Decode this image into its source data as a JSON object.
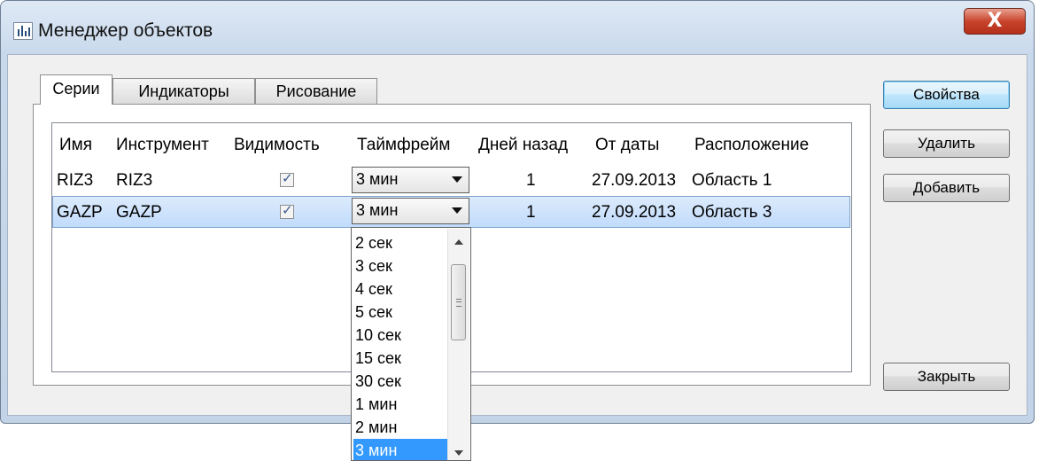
{
  "window": {
    "title": "Менеджер объектов",
    "close_glyph": "X"
  },
  "tabs": [
    {
      "label": "Серии",
      "active": true
    },
    {
      "label": "Индикаторы",
      "active": false
    },
    {
      "label": "Рисование",
      "active": false
    }
  ],
  "table": {
    "columns": [
      "Имя",
      "Инструмент",
      "Видимость",
      "Таймфрейм",
      "Дней назад",
      "От даты",
      "Расположение"
    ],
    "rows": [
      {
        "name": "RIZ3",
        "instrument": "RIZ3",
        "visible": true,
        "timeframe": "3 мин",
        "days_back": "1",
        "from_date": "27.09.2013",
        "location": "Область 1"
      },
      {
        "name": "GAZP",
        "instrument": "GAZP",
        "visible": true,
        "timeframe": "3 мин",
        "days_back": "1",
        "from_date": "27.09.2013",
        "location": "Область 3",
        "selected": true
      }
    ]
  },
  "timeframe_dropdown": {
    "options": [
      "2 сек",
      "3 сек",
      "4 сек",
      "5 сек",
      "10 сек",
      "15 сек",
      "30 сек",
      "1 мин",
      "2 мин",
      "3 мин"
    ],
    "selected": "3 мин"
  },
  "buttons": {
    "properties": "Свойства",
    "delete": "Удалить",
    "add": "Добавить",
    "close": "Закрыть"
  },
  "colors": {
    "selection": "#3399ff",
    "row_selected": "#cde3fc",
    "close_button": "#c8442c"
  }
}
